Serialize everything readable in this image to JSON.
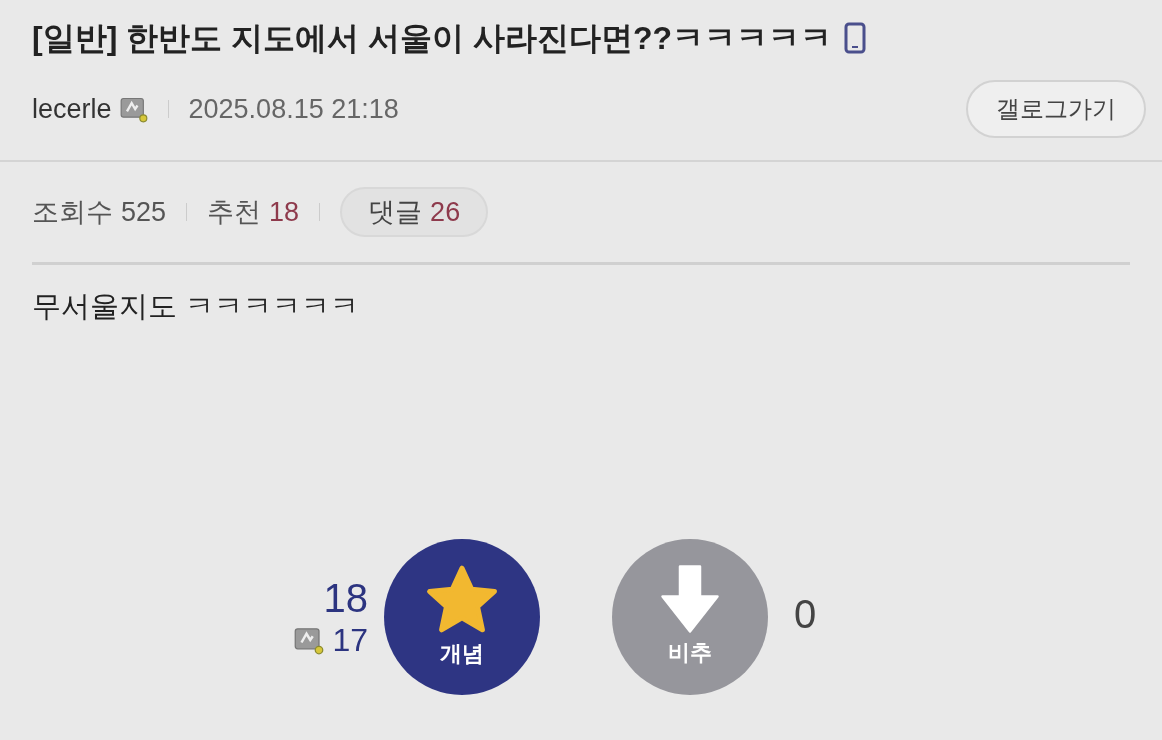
{
  "post": {
    "title": "[일반] 한반도 지도에서 서울이 사라진다면??ㅋㅋㅋㅋㅋ",
    "author": "lecerle",
    "date": "2025.08.15 21:18",
    "gallog_button": "갤로그가기"
  },
  "stats": [
    {
      "kind": "plain",
      "label": "조회수",
      "value": "525"
    },
    {
      "kind": "plain",
      "label": "추천",
      "value": "18"
    },
    {
      "kind": "pill",
      "label": "댓글",
      "value": "26"
    }
  ],
  "body": "무서울지도 ㅋㅋㅋㅋㅋㅋ",
  "vote": {
    "up_count": "18",
    "fixed_count": "17",
    "up_label": "개념",
    "down_label": "비추",
    "down_count": "0"
  }
}
